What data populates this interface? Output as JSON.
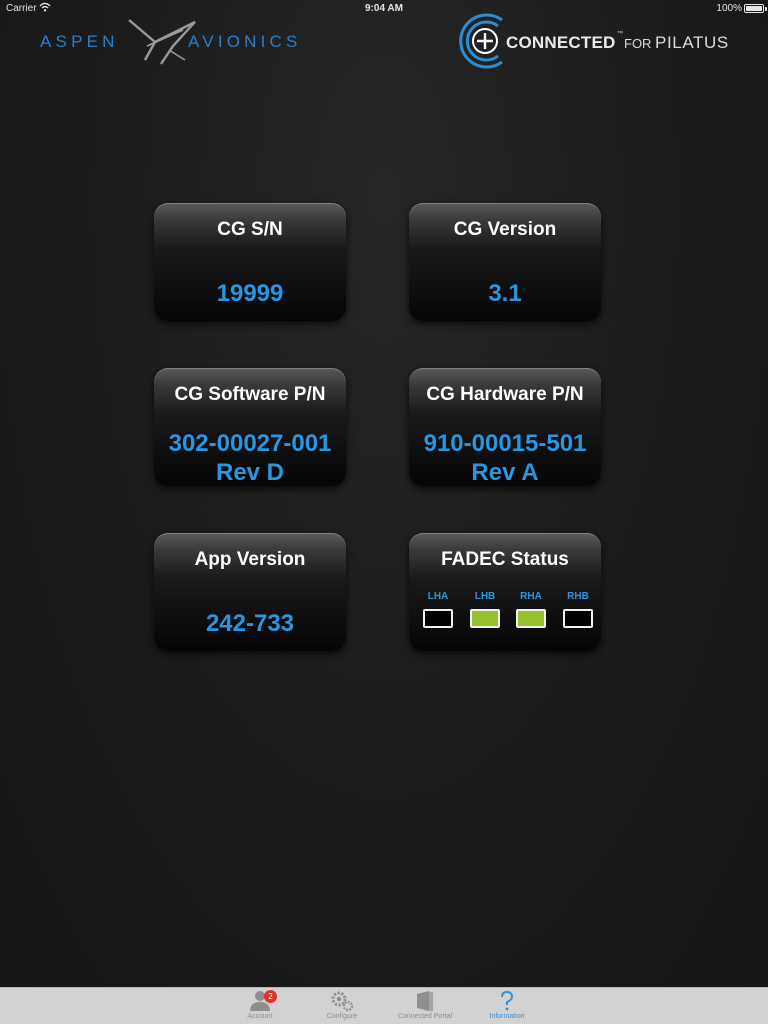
{
  "status_bar": {
    "carrier": "Carrier",
    "time": "9:04 AM",
    "battery": "100%"
  },
  "header": {
    "left_logo": {
      "word1": "ASPEN",
      "word2": "AVIONICS"
    },
    "right_logo": {
      "connected": "CONNECTED",
      "tm": "™",
      "for": "FOR",
      "brand": "PILATUS"
    }
  },
  "colors": {
    "accent_blue": "#2a95e0",
    "logo_blue": "#2b7ec6",
    "fadec_on": "#95c22e",
    "tab_active": "#3b8ed6",
    "badge_red": "#e33227"
  },
  "cards": {
    "cg_sn": {
      "title": "CG S/N",
      "value": "19999"
    },
    "cg_version": {
      "title": "CG Version",
      "value": "3.1"
    },
    "cg_software": {
      "title": "CG Software P/N",
      "value": "302-00027-001",
      "rev": "Rev D"
    },
    "cg_hardware": {
      "title": "CG Hardware P/N",
      "value": "910-00015-501",
      "rev": "Rev A"
    },
    "app_version": {
      "title": "App Version",
      "value": "242-733"
    },
    "fadec": {
      "title": "FADEC Status",
      "channels": [
        {
          "label": "LHA",
          "on": false
        },
        {
          "label": "LHB",
          "on": true
        },
        {
          "label": "RHA",
          "on": true
        },
        {
          "label": "RHB",
          "on": false
        }
      ]
    }
  },
  "tabbar": {
    "tabs": [
      {
        "label": "Account",
        "icon": "account-icon",
        "badge": "2"
      },
      {
        "label": "Configure",
        "icon": "gear-icon"
      },
      {
        "label": "Connected Portal",
        "icon": "portal-icon"
      },
      {
        "label": "Information",
        "icon": "question-icon",
        "active": true
      }
    ]
  }
}
